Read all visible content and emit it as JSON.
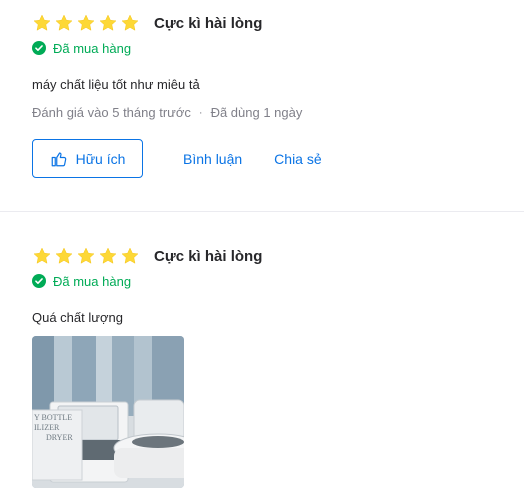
{
  "reviews": [
    {
      "rating": 5,
      "rating_title": "Cực kì hài lòng",
      "purchased_label": "Đã mua hàng",
      "content": "máy chất liệu tốt như miêu tả",
      "reviewed_time": "Đánh giá vào 5 tháng trước",
      "separator": "·",
      "used_time": "Đã dùng 1 ngày",
      "helpful_label": "Hữu ích",
      "comment_label": "Bình luận",
      "share_label": "Chia sẻ"
    },
    {
      "rating": 5,
      "rating_title": "Cực kì hài lòng",
      "purchased_label": "Đã mua hàng",
      "content": "Quá chất lượng",
      "photo_text_lines": [
        "Y BOTTLE",
        "ILIZER",
        "DRYER"
      ]
    }
  ],
  "colors": {
    "star": "#fdd836",
    "purchased": "#00ab56",
    "link": "#0b74e5",
    "muted": "#808089"
  }
}
